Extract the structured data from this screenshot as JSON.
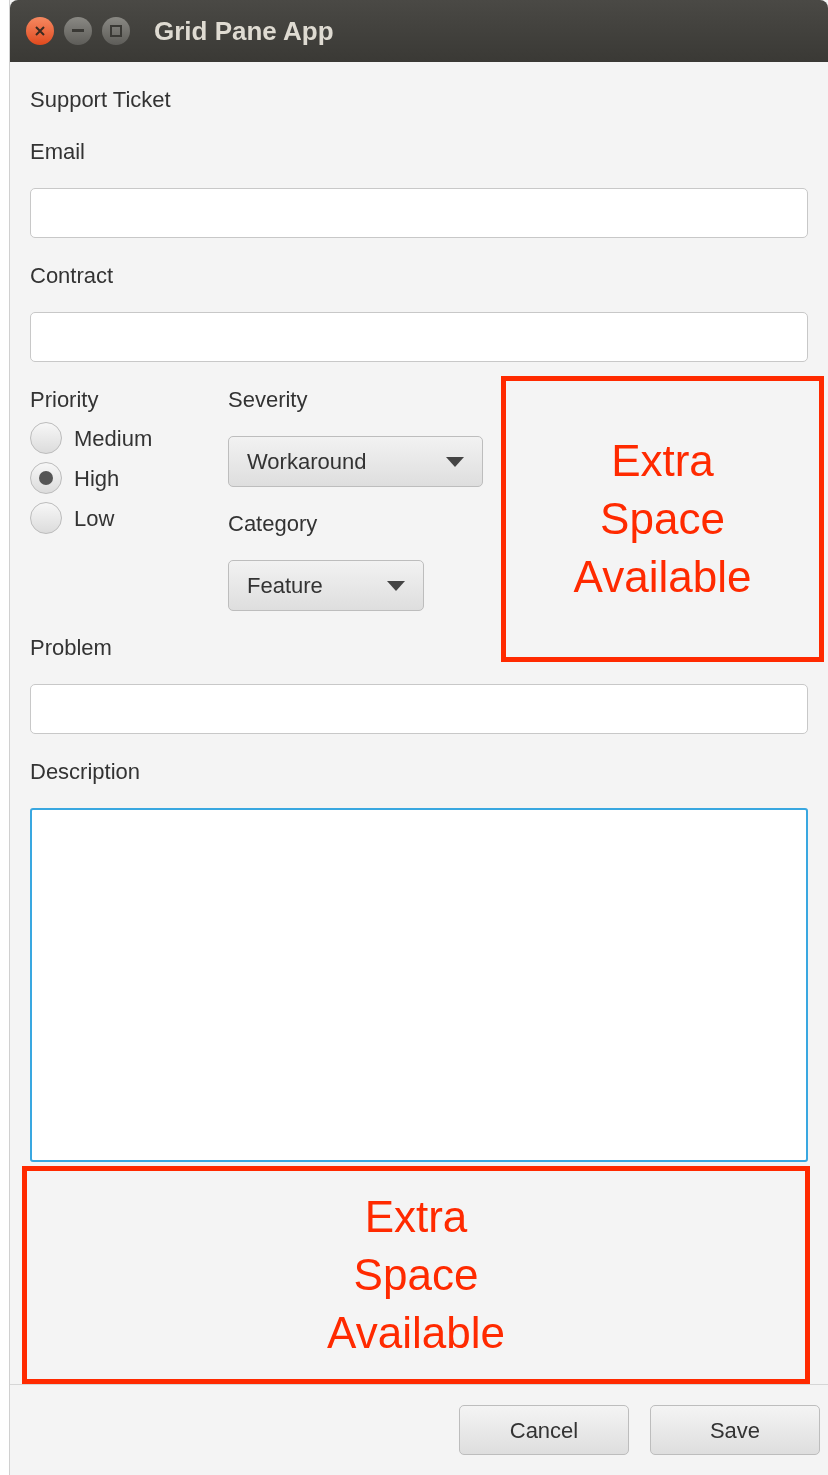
{
  "window": {
    "title": "Grid Pane App"
  },
  "form": {
    "heading": "Support Ticket",
    "email": {
      "label": "Email"
    },
    "contract": {
      "label": "Contract"
    },
    "priority": {
      "label": "Priority",
      "options": [
        {
          "label": "Medium",
          "selected": false
        },
        {
          "label": "High",
          "selected": true
        },
        {
          "label": "Low",
          "selected": false
        }
      ]
    },
    "severity": {
      "label": "Severity",
      "value": "Workaround"
    },
    "category": {
      "label": "Category",
      "value": "Feature"
    },
    "problem": {
      "label": "Problem"
    },
    "description": {
      "label": "Description",
      "focused": true
    }
  },
  "annotations": [
    {
      "lines": [
        "Extra",
        "Space",
        "Available"
      ]
    },
    {
      "lines": [
        "Extra",
        "Space",
        "Available"
      ]
    }
  ],
  "buttons": [
    "Cancel",
    "Save"
  ]
}
